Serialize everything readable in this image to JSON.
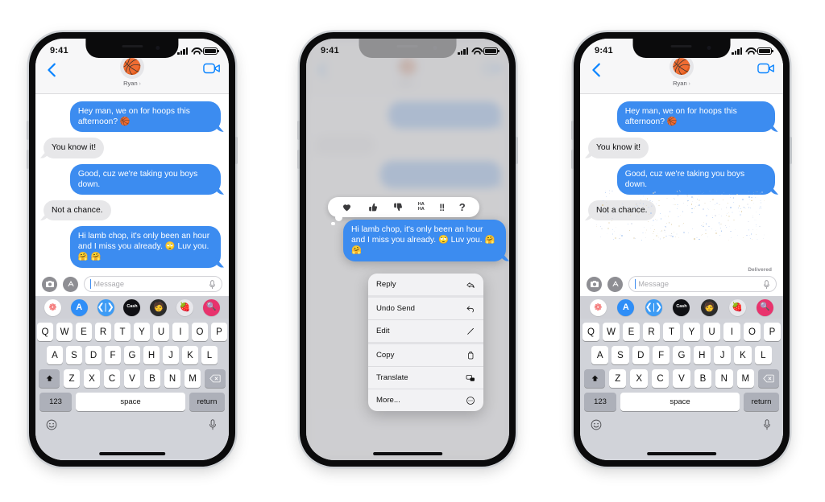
{
  "page": {
    "background": "#ffffff",
    "title": "iMessage Undo Send sequence"
  },
  "theme": {
    "bubble_out": "#3c8cf0",
    "bubble_in": "#e7e7e9",
    "accent_blue": "#0a84ff",
    "keyboard_bg": "#d1d3d9",
    "drawer_bg": "#cfd0d6",
    "menu_bg": "#f2f2f4"
  },
  "status_bar": {
    "time": "9:41",
    "signal": "signal-bars-icon",
    "wifi": "wifi-icon",
    "battery": "battery-icon"
  },
  "nav": {
    "back": "back-chevron-icon",
    "avatar_emoji": "🏀",
    "contact_name": "Ryan",
    "chevron": "›",
    "facetime": "facetime-video-icon"
  },
  "messages": [
    {
      "id": "m1",
      "side": "out",
      "text": "Hey man, we on for hoops this afternoon? 🏀"
    },
    {
      "id": "m2",
      "side": "in",
      "text": "You know it!"
    },
    {
      "id": "m3",
      "side": "out",
      "text": "Good, cuz we're taking you boys down."
    },
    {
      "id": "m4",
      "side": "in",
      "text": "Not a chance."
    },
    {
      "id": "m5",
      "side": "out",
      "text": "Hi lamb chop, it's only been an hour and I miss you already. 🙄 Luv you. 🤗 🤗"
    }
  ],
  "delivered_label": "Delivered",
  "composer": {
    "camera_icon": "camera-icon",
    "appstore_icon": "app-store-icon",
    "placeholder": "Message",
    "mic_icon": "microphone-icon"
  },
  "app_drawer": [
    {
      "name": "photos-app-icon",
      "glyph": "❁",
      "bg": "#ffffff",
      "color": "#f04a4a"
    },
    {
      "name": "app-store-icon",
      "glyph": "A",
      "bg": "#2f8ef7",
      "color": "#ffffff"
    },
    {
      "name": "music-wave-icon",
      "glyph": "◉",
      "bg": "#3c9bf5",
      "color": "#ffffff"
    },
    {
      "name": "apple-cash-icon",
      "glyph": "Cash",
      "bg": "#101014",
      "color": "#ffffff"
    },
    {
      "name": "memoji-sticker-icon",
      "glyph": "🧑",
      "bg": "#2b2b2b",
      "color": "#ffffff"
    },
    {
      "name": "photo-sticker-icon",
      "glyph": "🍓",
      "bg": "#e8e8ec",
      "color": "#333333"
    },
    {
      "name": "image-search-icon",
      "glyph": "🔍",
      "bg": "#e8336d",
      "color": "#ffffff"
    }
  ],
  "keyboard": {
    "row1": [
      "Q",
      "W",
      "E",
      "R",
      "T",
      "Y",
      "U",
      "I",
      "O",
      "P"
    ],
    "row2": [
      "A",
      "S",
      "D",
      "F",
      "G",
      "H",
      "J",
      "K",
      "L"
    ],
    "row3": [
      "Z",
      "X",
      "C",
      "V",
      "B",
      "N",
      "M"
    ],
    "shift_icon": "shift-up-arrow-icon",
    "backspace_icon": "backspace-delete-icon",
    "numbers_key": "123",
    "space_key": "space",
    "return_key": "return",
    "emoji_icon": "emoji-smiley-icon",
    "dictation_icon": "microphone-icon"
  },
  "tapbacks": [
    {
      "name": "heart-tapback",
      "glyph": "♥"
    },
    {
      "name": "thumbs-up-tapback",
      "glyph": "👍"
    },
    {
      "name": "thumbs-down-tapback",
      "glyph": "👎"
    },
    {
      "name": "haha-tapback",
      "glyph": "HA\nHA"
    },
    {
      "name": "exclamation-tapback",
      "glyph": "‼"
    },
    {
      "name": "question-tapback",
      "glyph": "?"
    }
  ],
  "context_menu": [
    {
      "label": "Reply",
      "icon": "reply-arrow-icon",
      "divider": "thick"
    },
    {
      "label": "Undo Send",
      "icon": "undo-arrow-icon",
      "divider": "thin"
    },
    {
      "label": "Edit",
      "icon": "pencil-edit-icon",
      "divider": "thick"
    },
    {
      "label": "Copy",
      "icon": "copy-duplicate-icon",
      "divider": "thin"
    },
    {
      "label": "Translate",
      "icon": "translate-bubbles-icon",
      "divider": "thin"
    },
    {
      "label": "More...",
      "icon": "more-ellipsis-icon",
      "divider": "none"
    }
  ],
  "phones": [
    {
      "id": "phone-left",
      "state": "conversation-with-keyboard"
    },
    {
      "id": "phone-center",
      "state": "long-press-context-menu"
    },
    {
      "id": "phone-right",
      "state": "message-unsent-dissolving"
    }
  ]
}
